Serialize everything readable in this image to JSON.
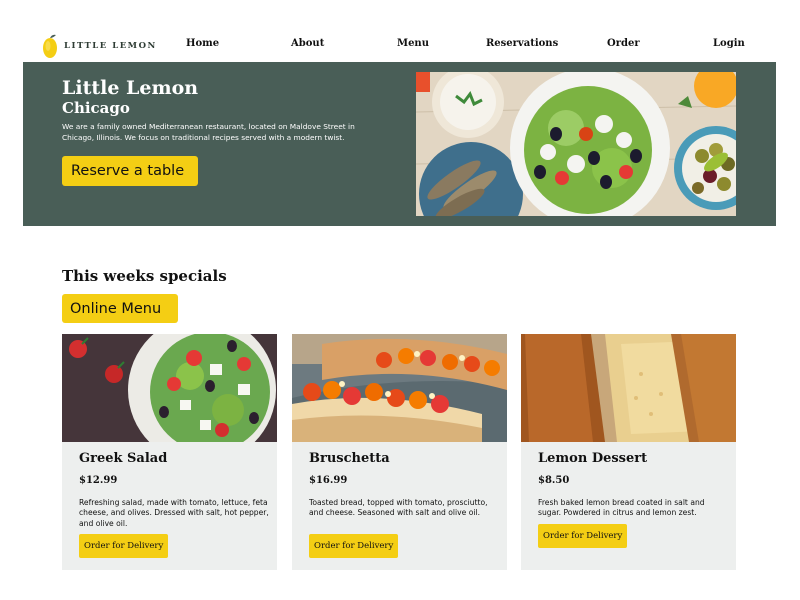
{
  "brand": {
    "name": "LITTLE LEMON"
  },
  "nav": {
    "home": "Home",
    "about": "About",
    "menu": "Menu",
    "reservations": "Reservations",
    "order": "Order",
    "login": "Login"
  },
  "hero": {
    "title": "Little Lemon",
    "subtitle": "Chicago",
    "description": "We are a family owned Mediterranean restaurant, located on Maldove Street in Chicago, Illinois. We focus on traditional recipes served with a modern twist.",
    "cta_label": "Reserve a table"
  },
  "specials": {
    "heading": "This weeks specials",
    "cta_label": "Online Menu",
    "items": [
      {
        "title": "Greek Salad",
        "price": "$12.99",
        "description": "Refreshing salad, made with tomato, lettuce, feta cheese, and olives. Dressed with salt, hot pepper, and olive oil.",
        "button": "Order for Delivery"
      },
      {
        "title": "Bruschetta",
        "price": "$16.99",
        "description": "Toasted bread, topped with tomato, prosciutto, and cheese. Seasoned with salt and olive oil.",
        "button": "Order for Delivery"
      },
      {
        "title": "Lemon Dessert",
        "price": "$8.50",
        "description": "Fresh baked lemon bread coated in salt and sugar. Powdered in citrus and lemon zest.",
        "button": "Order for Delivery"
      }
    ]
  },
  "colors": {
    "primary_green": "#495e57",
    "primary_yellow": "#f4ce14",
    "card_bg": "#edefee"
  }
}
